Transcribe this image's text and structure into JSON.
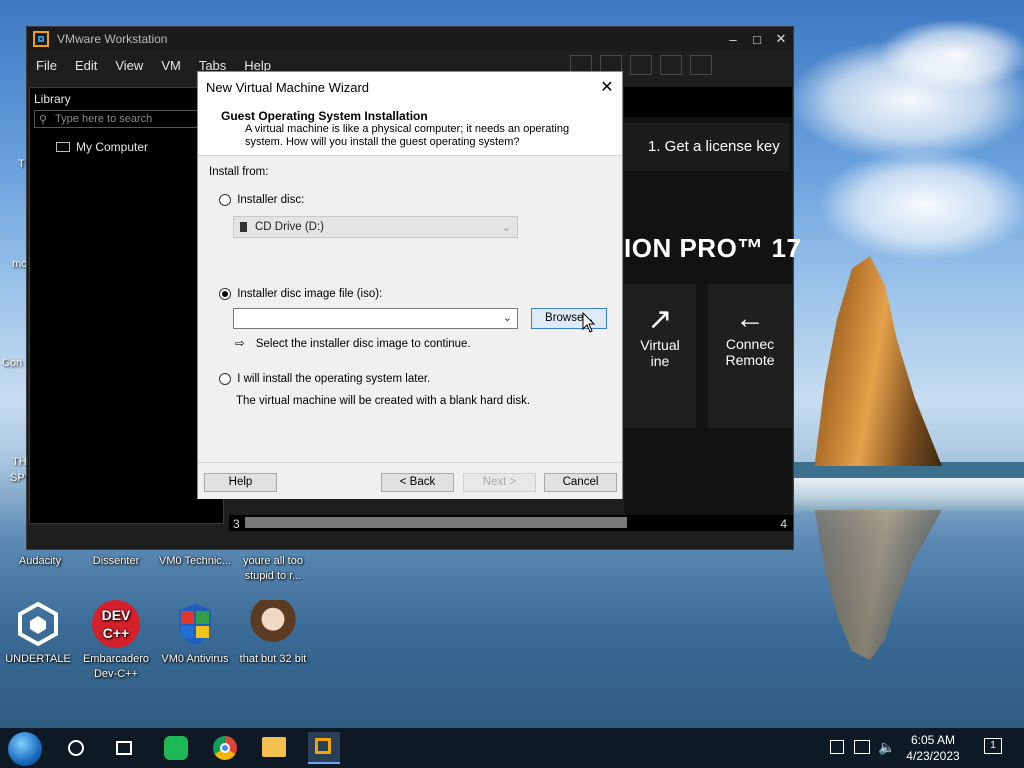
{
  "desktop": {
    "icons": [
      {
        "label": "Audacity"
      },
      {
        "label": "Dissenter"
      },
      {
        "label": "VM0 Technic..."
      },
      {
        "label": "youre all too stupid to r..."
      },
      {
        "label": "UNDERTALE"
      },
      {
        "label": "Embarcadero Dev-C++"
      },
      {
        "label": "VM0 Antivirus"
      },
      {
        "label": "that but 32 bit"
      }
    ],
    "edge_labels": [
      "T",
      "mo",
      "Con",
      "TH",
      "SPY"
    ]
  },
  "vmware": {
    "title": "VMware Workstation",
    "menu": [
      "File",
      "Edit",
      "View",
      "VM",
      "Tabs",
      "Help"
    ],
    "library_title": "Library",
    "search_placeholder": "Type here to search",
    "tree_item": "My Computer",
    "home": {
      "license": "1. Get a license key",
      "brand": "ION PRO™ 17",
      "card1": "Virtual\nine",
      "card2": "Connec\nRemote"
    },
    "status_left": "3",
    "status_right": "4"
  },
  "wizard": {
    "title": "New Virtual Machine Wizard",
    "heading": "Guest Operating System Installation",
    "description_line1": "A virtual machine is like a physical computer; it needs an operating",
    "description_line2": "system. How will you install the guest operating system?",
    "install_from": "Install from:",
    "opt_disc": "Installer disc:",
    "cd_drive": "CD Drive (D:)",
    "opt_iso": "Installer disc image file (iso):",
    "iso_value": "",
    "browse": "Browse...",
    "hint": "Select the installer disc image to continue.",
    "opt_later": "I will install the operating system later.",
    "later_desc": "The virtual machine will be created with a blank hard disk.",
    "selected_option": "iso",
    "buttons": {
      "help": "Help",
      "back": "< Back",
      "next": "Next >",
      "cancel": "Cancel"
    }
  },
  "taskbar": {
    "time": "6:05 AM",
    "date": "4/23/2023",
    "notification_count": "1"
  },
  "colors": {
    "vmware_accent": "#f0a30a",
    "focus_blue": "#3c7fd0"
  }
}
